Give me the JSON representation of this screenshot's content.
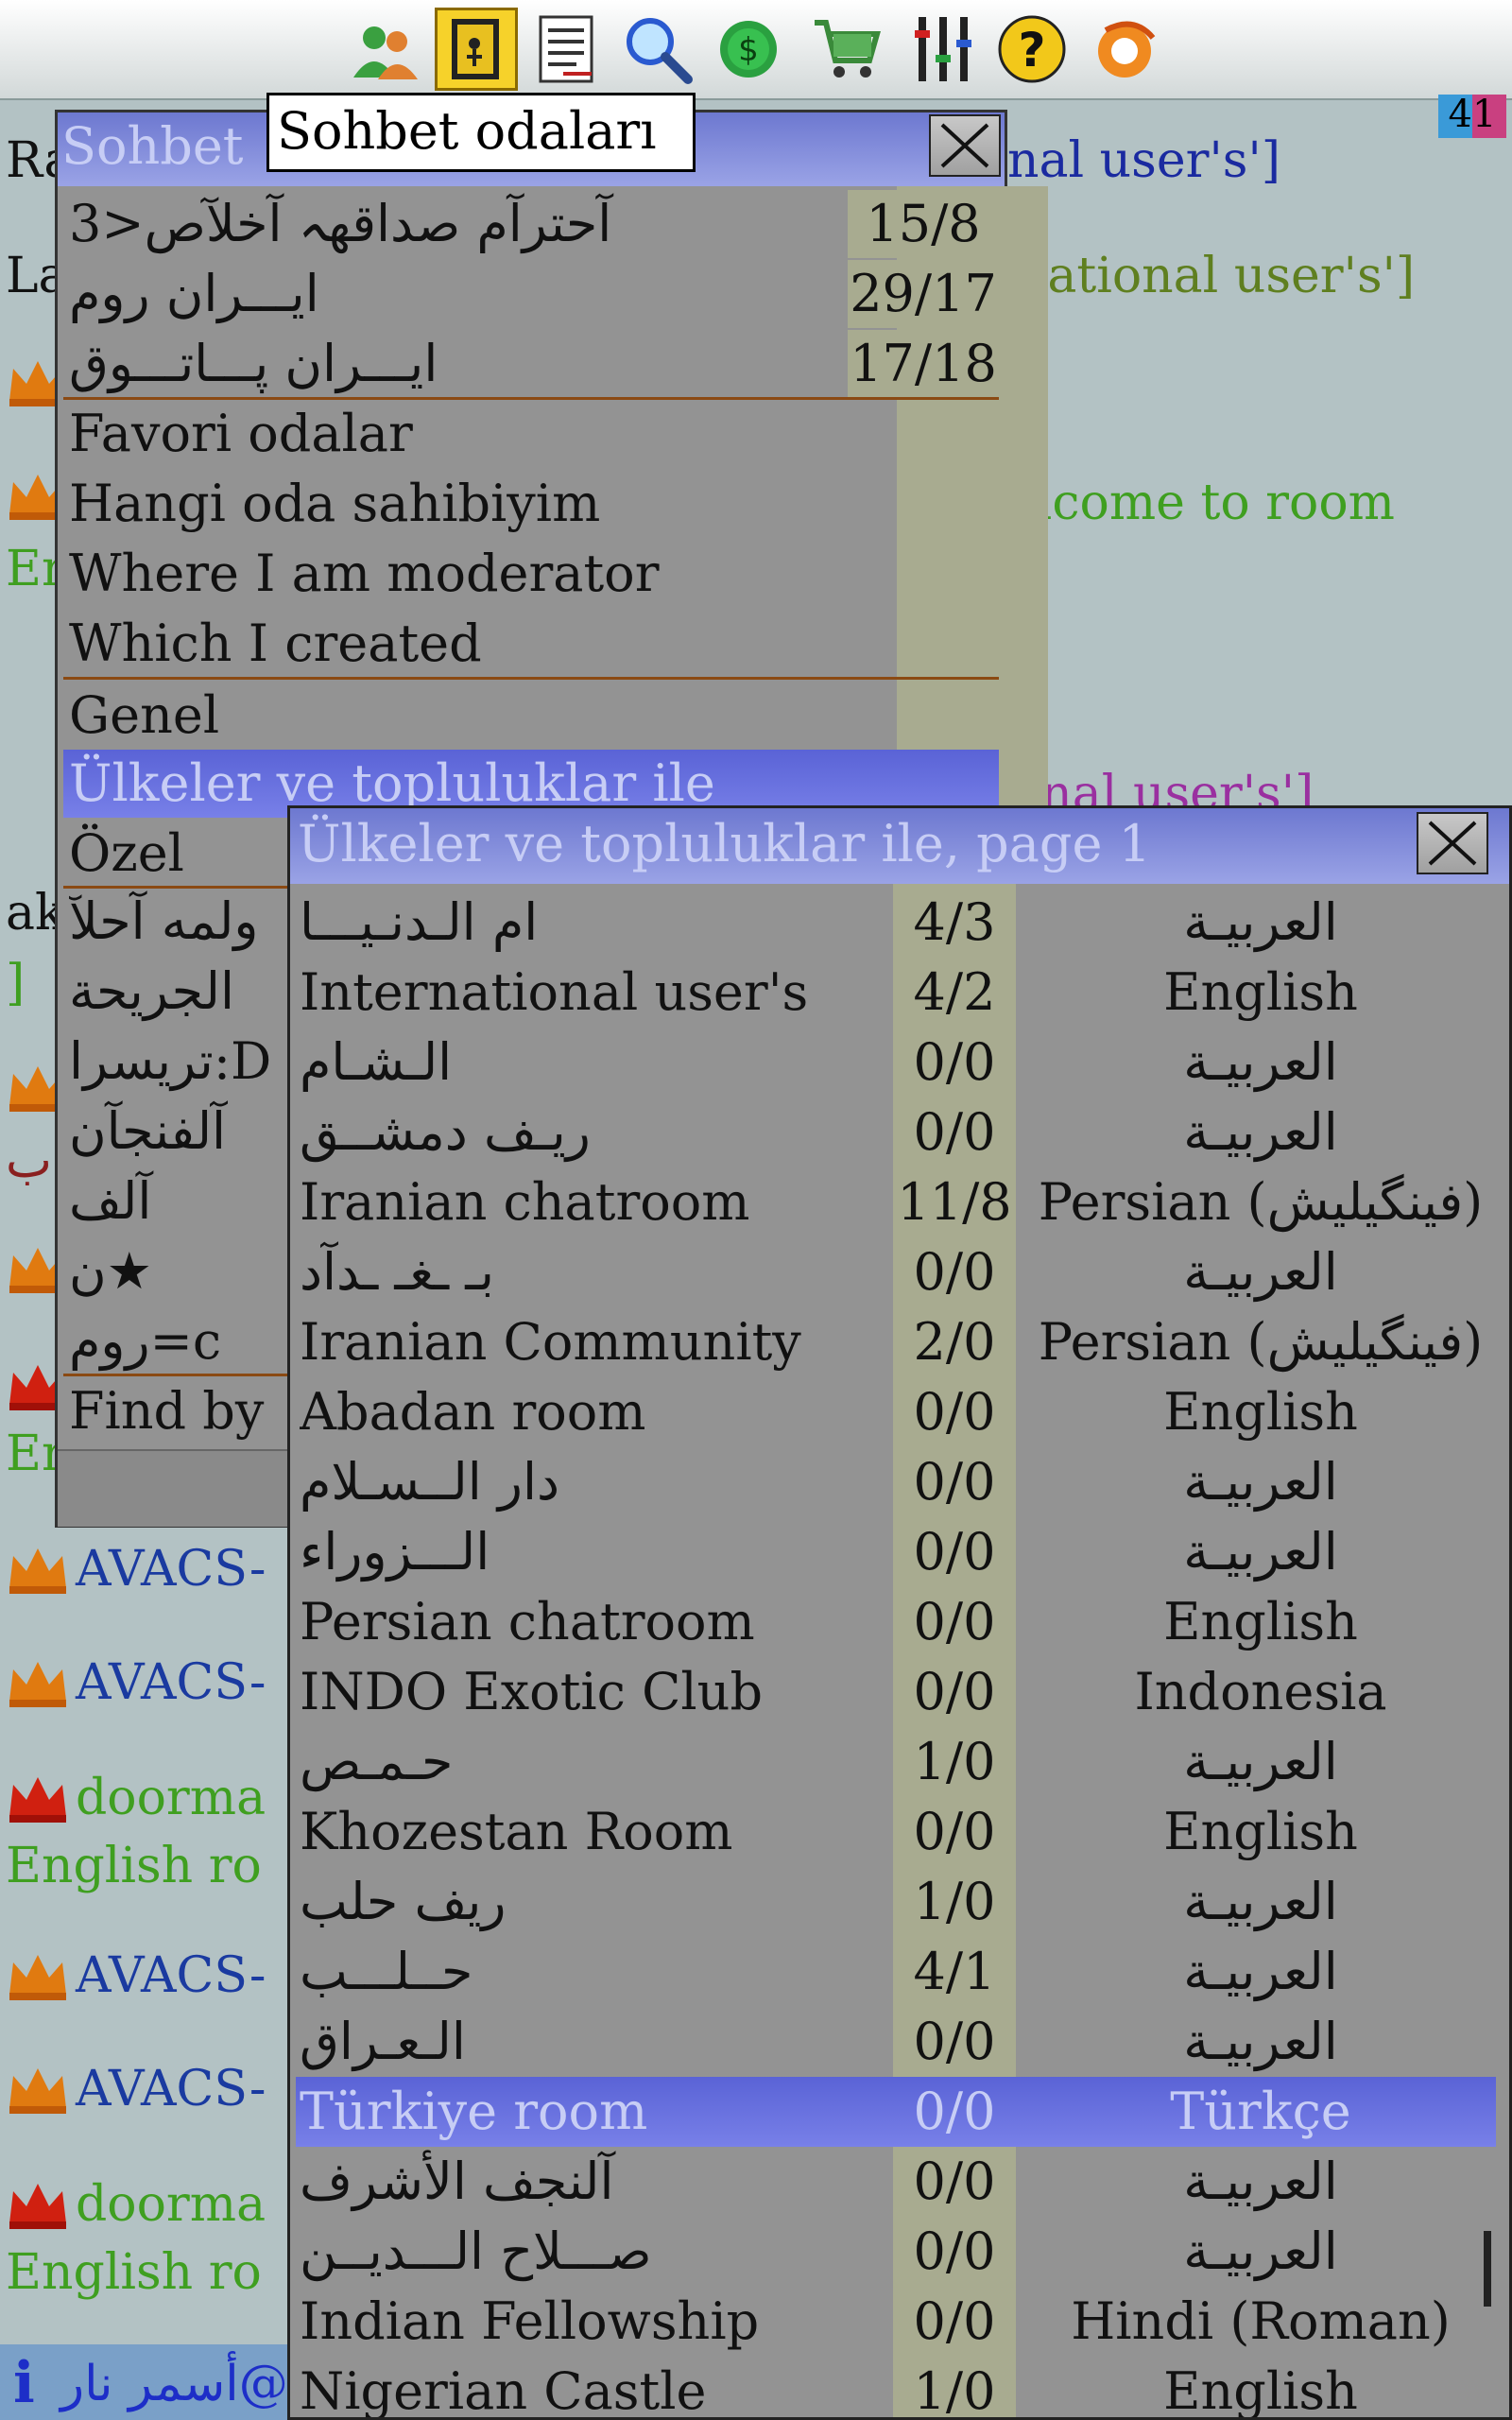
{
  "toolbar": {
    "icons": [
      "users-icon",
      "rooms-icon",
      "list-icon",
      "search-icon",
      "coin-icon",
      "cart-icon",
      "equalizer-icon",
      "help-icon",
      "logo-icon"
    ],
    "active": "rooms-icon"
  },
  "counter": "41",
  "background_chat": [
    {
      "text": "Ra",
      "color": "#111"
    },
    {
      "text": "nal user's']",
      "color": "#1a2aa0"
    },
    {
      "text": "La",
      "color": "#111"
    },
    {
      "text": "rnational user's']",
      "color": "#5f7f20"
    },
    {
      "text": "elcome to room",
      "color": "#3f9f20"
    },
    {
      "text": "Er",
      "color": "#3f9f20"
    },
    {
      "text": "onal user's']",
      "color": "#9a2fa0"
    },
    {
      "text": "ak",
      "color": "#111"
    },
    {
      "text": "]",
      "color": "#3f9f20"
    },
    {
      "text": "ب",
      "color": "#8a2020"
    },
    {
      "text": "Er",
      "color": "#3f9f20"
    },
    {
      "text": "AVACS-",
      "color": "#1a3aa0"
    },
    {
      "text": "AVACS-",
      "color": "#1a3aa0"
    },
    {
      "text": "doorma",
      "color": "#3f9f20"
    },
    {
      "text": "English ro",
      "color": "#3f9f20"
    },
    {
      "text": "AVACS-",
      "color": "#1a3aa0"
    },
    {
      "text": "AVACS-",
      "color": "#1a3aa0"
    },
    {
      "text": "doorma",
      "color": "#3f9f20"
    },
    {
      "text": "English ro",
      "color": "#3f9f20"
    }
  ],
  "menu": {
    "title": "Sohbet",
    "tooltip": "Sohbet odaları",
    "rooms": [
      {
        "name": "آحترآم صداقهہ آخلآص<3",
        "count": "15/8"
      },
      {
        "name": "ايـــران روم",
        "count": "29/17"
      },
      {
        "name": "ايـــران پـــاتـــوق",
        "count": "17/18"
      }
    ],
    "sections": [
      "Favori odalar",
      "Hangi oda sahibiyim",
      "Where I am moderator",
      "Which I created"
    ],
    "categories": [
      "Genel",
      "Ülkeler ve topluluklar ile",
      "Özel"
    ],
    "selected_category": "Ülkeler ve topluluklar ile",
    "others": [
      "ولمه آحلآ",
      "الجريحة",
      "تريسرا:D",
      "آلفنجآن",
      "آلف",
      "ن★",
      "روم=c"
    ],
    "find": "Find by"
  },
  "rooms_window": {
    "title": "Ülkeler ve topluluklar ile, page 1",
    "rows": [
      {
        "name": "ام الـدنـيـــا",
        "count": "4/3",
        "lang": "العربيـة"
      },
      {
        "name": "International user's",
        "count": "4/2",
        "lang": "English"
      },
      {
        "name": "الـشـام",
        "count": "0/0",
        "lang": "العربيـة"
      },
      {
        "name": "ريـف دمشــق",
        "count": "0/0",
        "lang": "العربيـة"
      },
      {
        "name": "Iranian chatroom",
        "count": "11/8",
        "lang": "Persian (فینگیلیش)"
      },
      {
        "name": "بـ ـغـ ـدآد",
        "count": "0/0",
        "lang": "العربيـة"
      },
      {
        "name": "Iranian Community",
        "count": "2/0",
        "lang": "Persian (فینگیلیش)"
      },
      {
        "name": "Abadan room",
        "count": "0/0",
        "lang": "English"
      },
      {
        "name": "دار الــسـلام",
        "count": "0/0",
        "lang": "العربيـة"
      },
      {
        "name": "الـــزوراء",
        "count": "0/0",
        "lang": "العربيـة"
      },
      {
        "name": "Persian chatroom",
        "count": "0/0",
        "lang": "English"
      },
      {
        "name": "INDO Exotic Club",
        "count": "0/0",
        "lang": "Indonesia"
      },
      {
        "name": "حـمـص",
        "count": "1/0",
        "lang": "العربيـة"
      },
      {
        "name": "Khozestan Room",
        "count": "0/0",
        "lang": "English"
      },
      {
        "name": "ريف حلب",
        "count": "1/0",
        "lang": "العربيـة"
      },
      {
        "name": "حــلـــب",
        "count": "4/1",
        "lang": "العربيـة"
      },
      {
        "name": "الـعـراق",
        "count": "0/0",
        "lang": "العربيـة"
      },
      {
        "name": "Türkiye room",
        "count": "0/0",
        "lang": "Türkçe"
      },
      {
        "name": "آلنجف الأشرف",
        "count": "0/0",
        "lang": "العربيـة"
      },
      {
        "name": "صـــلاح الـــديــن",
        "count": "0/0",
        "lang": "العربيـة"
      },
      {
        "name": "Indian Fellowship",
        "count": "0/0",
        "lang": "Hindi (Roman)"
      },
      {
        "name": "Nigerian Castle",
        "count": "1/0",
        "lang": "English"
      }
    ],
    "selected_index": 17
  },
  "status": {
    "icon": "info-icon",
    "text": "أسمر نار@"
  },
  "colors": {
    "accent": "#6d78d0",
    "panel": "#939393",
    "count_col": "#a8ab90",
    "separator": "#8b4a13"
  }
}
